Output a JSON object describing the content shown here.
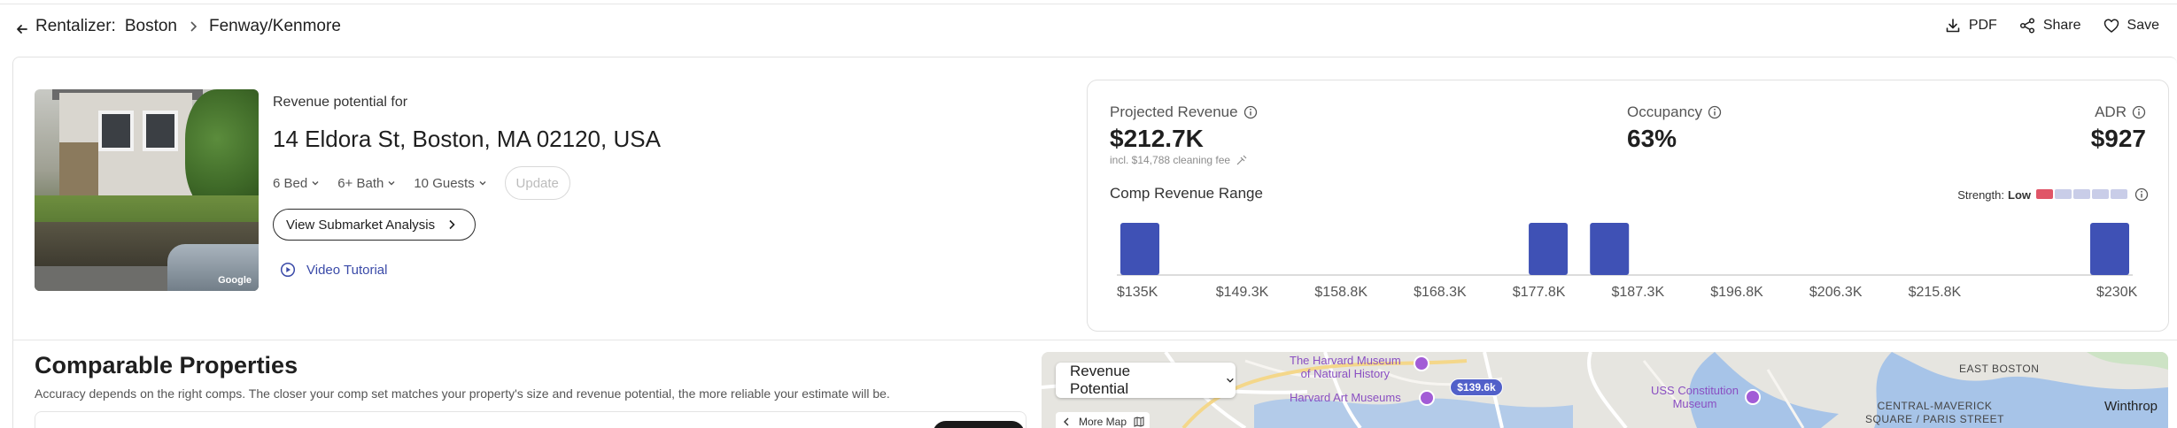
{
  "breadcrumb": {
    "root": "Rentalizer:",
    "city": "Boston",
    "area": "Fenway/Kenmore"
  },
  "actions": {
    "pdf": "PDF",
    "share": "Share",
    "save": "Save"
  },
  "property": {
    "revenue_label": "Revenue potential for",
    "address": "14 Eldora St, Boston, MA 02120, USA",
    "photo_credit": "Google",
    "beds": "6 Bed",
    "baths": "6+ Bath",
    "guests": "10 Guests",
    "update_label": "Update",
    "submarket_label": "View Submarket Analysis",
    "video_label": "Video Tutorial"
  },
  "metrics": {
    "projected_label": "Projected Revenue",
    "projected_value": "$212.7K",
    "cleaning_note": "incl. $14,788 cleaning fee",
    "occupancy_label": "Occupancy",
    "occupancy_value": "63%",
    "adr_label": "ADR",
    "adr_value": "$927"
  },
  "comp_range": {
    "title": "Comp Revenue Range",
    "strength_label": "Strength:",
    "strength_value": "Low",
    "strength_level": 1,
    "strength_max": 5
  },
  "chart_data": {
    "type": "bar",
    "title": "Comp Revenue Range",
    "tick_labels": [
      "$135K",
      "$149.3K",
      "$158.8K",
      "$168.3K",
      "$177.8K",
      "$187.3K",
      "$196.8K",
      "$206.3K",
      "$215.8K",
      "$230K"
    ],
    "bins": [
      {
        "x": 135,
        "value": 1
      },
      {
        "x": 175,
        "value": 1
      },
      {
        "x": 181,
        "value": 1
      },
      {
        "x": 230,
        "value": 1
      }
    ],
    "xlim": [
      135,
      230
    ],
    "ylim": [
      0,
      1
    ],
    "bar_color": "#3f51b5"
  },
  "comparable": {
    "title": "Comparable Properties",
    "subtitle": "Accuracy depends on the right comps. The closer your comp set matches your property's size and revenue potential, the more reliable your estimate will be."
  },
  "map": {
    "select_value": "Revenue Potential",
    "more_map": "More Map",
    "price_pill": "$139.6k",
    "labels": {
      "harvard_museum": "The Harvard Museum\nof Natural History",
      "harvard_art": "Harvard Art Museums",
      "uss": "USS Constitution\nMuseum",
      "east_boston": "EAST BOSTON",
      "central_maverick": "CENTRAL-MAVERICK\nSQUARE / PARIS STREET",
      "winthrop": "Winthrop"
    }
  }
}
